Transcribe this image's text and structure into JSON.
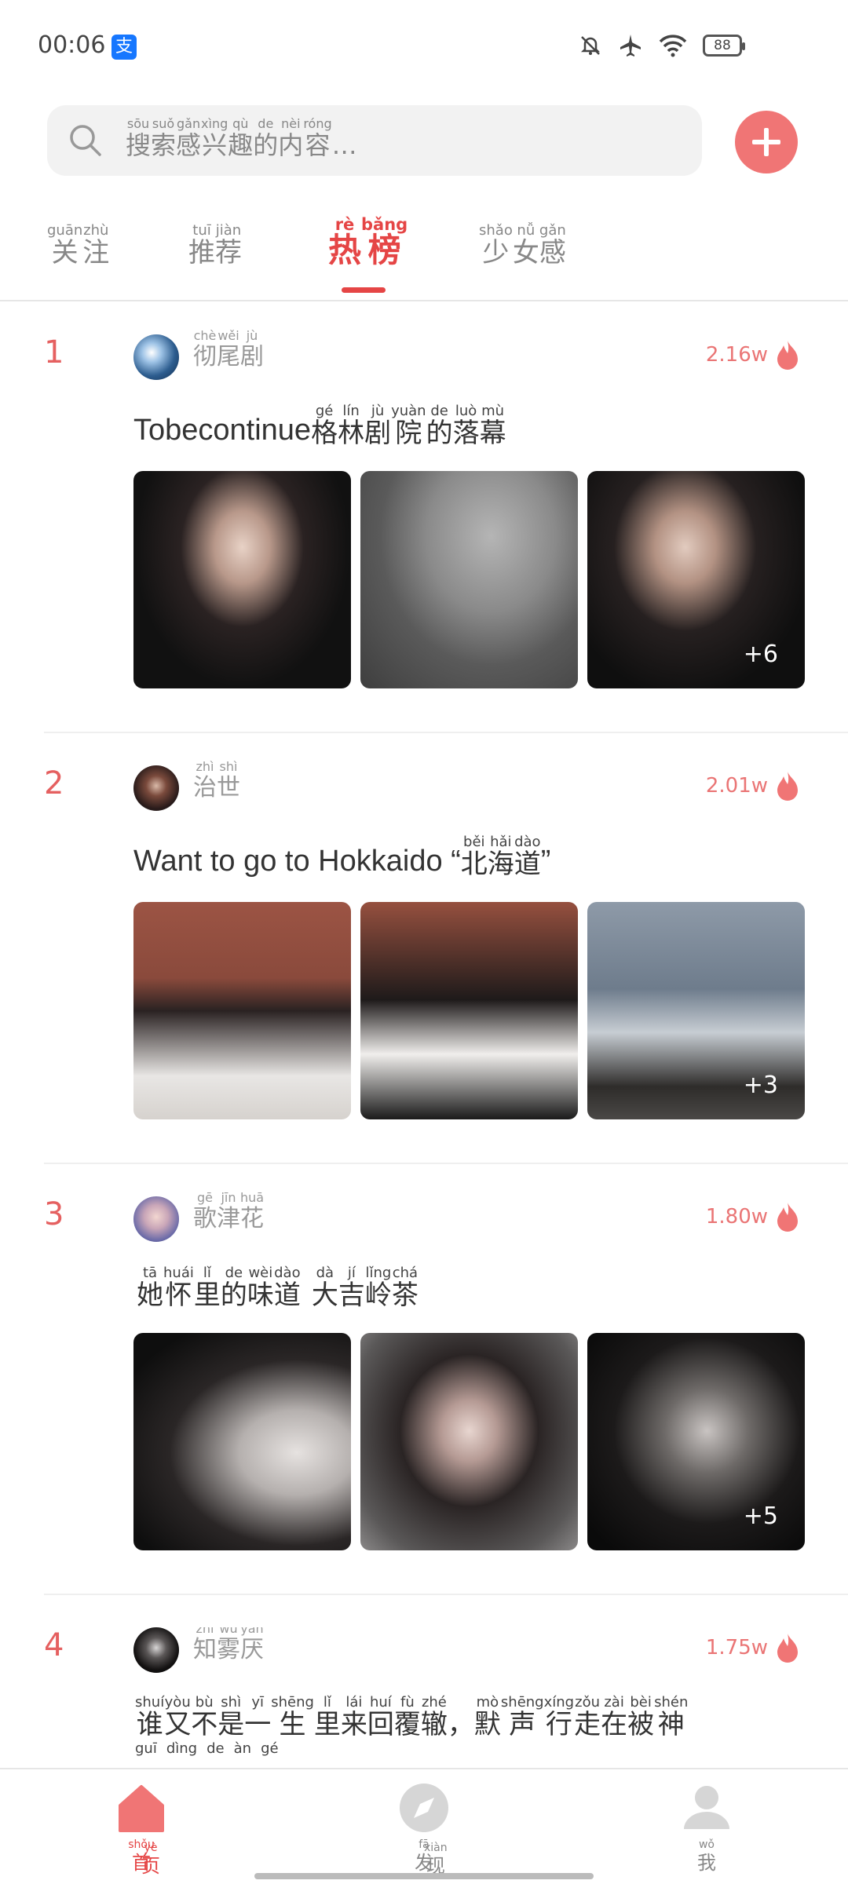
{
  "status_bar": {
    "time": "00:06",
    "app_badge": "支",
    "battery": "88",
    "icons": [
      "mute-bell-icon",
      "airplane-icon",
      "wifi-icon",
      "battery-icon"
    ]
  },
  "search": {
    "placeholder_pinyin": [
      "sōu",
      "suǒ",
      "gǎn",
      "xìng",
      "qù",
      "de",
      "nèi",
      "róng",
      ""
    ],
    "placeholder_chars": [
      "搜",
      "索",
      "感",
      "兴",
      "趣",
      "的",
      "内",
      "容",
      "…"
    ]
  },
  "colors": {
    "accent": "#e54545",
    "heat": "#f07575"
  },
  "tabs": [
    {
      "pinyin": [
        "guān",
        "zhù"
      ],
      "chars": [
        "关",
        "注"
      ],
      "active": false
    },
    {
      "pinyin": [
        "tuī",
        "jiàn"
      ],
      "chars": [
        "推",
        "荐"
      ],
      "active": false
    },
    {
      "pinyin": [
        "rè",
        "bǎng"
      ],
      "chars": [
        "热",
        "榜"
      ],
      "active": true
    },
    {
      "pinyin": [
        "shǎo",
        "nǚ",
        "gǎn"
      ],
      "chars": [
        "少",
        "女",
        "感"
      ],
      "active": false
    }
  ],
  "posts": [
    {
      "rank": "1",
      "author_pinyin": [
        "chè",
        "wěi",
        "jù"
      ],
      "author_chars": [
        "彻",
        "尾",
        "剧"
      ],
      "heat": "2.16w",
      "title_prefix": "Tobecontinue",
      "title_pinyin": [
        "gé",
        "lín",
        "jù",
        "yuàn",
        "de",
        "luò",
        "mù"
      ],
      "title_chars": [
        "格",
        "林",
        "剧",
        "院",
        "的",
        "落",
        "幕"
      ],
      "more_count": "+6"
    },
    {
      "rank": "2",
      "author_pinyin": [
        "zhì",
        "shì"
      ],
      "author_chars": [
        "治",
        "世"
      ],
      "heat": "2.01w",
      "title_prefix": "Want to go to Hokkaido “",
      "title_pinyin": [
        "běi",
        "hǎi",
        "dào"
      ],
      "title_chars": [
        "北",
        "海",
        "道"
      ],
      "title_suffix": "”",
      "more_count": "+3"
    },
    {
      "rank": "3",
      "author_pinyin": [
        "gē",
        "jīn",
        "huā"
      ],
      "author_chars": [
        "歌",
        "津",
        "花"
      ],
      "heat": "1.80w",
      "title_pinyin": [
        "tā",
        "huái",
        "lǐ",
        "de",
        "wèi",
        "dào",
        "",
        "dà",
        "jí",
        "lǐng",
        "chá"
      ],
      "title_chars": [
        "她",
        "怀",
        "里",
        "的",
        "味",
        "道",
        " ",
        "大",
        "吉",
        "岭",
        "茶"
      ],
      "more_count": "+5"
    },
    {
      "rank": "4",
      "author_pinyin": [
        "zhī",
        "wù",
        "yàn"
      ],
      "author_chars": [
        "知",
        "雾",
        "厌"
      ],
      "heat": "1.75w",
      "title_pinyin": [
        "shuí",
        "yòu",
        "bù",
        "shì",
        "yī",
        "shēng",
        "lǐ",
        "lái",
        "huí",
        "fù",
        "zhé",
        "",
        "mò",
        "shēng",
        "xíng",
        "zǒu",
        "zài",
        "bèi",
        "shén"
      ],
      "title_chars": [
        "谁",
        "又",
        "不",
        "是",
        "一",
        "生",
        "里",
        "来",
        "回",
        "覆",
        "辙",
        "，",
        "默",
        "声",
        "行",
        "走",
        "在",
        "被",
        "神"
      ],
      "title_line2_pinyin": [
        "guī",
        "dìng",
        "de",
        "àn",
        "gé"
      ]
    }
  ],
  "bottom_nav": [
    {
      "pinyin": [
        "shǒu",
        "yè"
      ],
      "chars": [
        "首",
        "页"
      ],
      "icon": "home-icon",
      "active": true
    },
    {
      "pinyin": [
        "fā",
        "xiàn"
      ],
      "chars": [
        "发",
        "现"
      ],
      "icon": "compass-icon",
      "active": false
    },
    {
      "pinyin": [
        "wǒ"
      ],
      "chars": [
        "我"
      ],
      "icon": "user-icon",
      "active": false
    }
  ]
}
